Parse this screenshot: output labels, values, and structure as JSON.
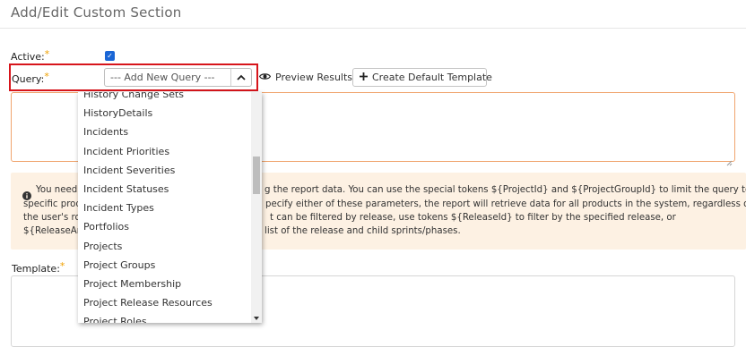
{
  "page": {
    "title": "Add/Edit Custom Section"
  },
  "form": {
    "active_label": "Active:",
    "required_mark": "*",
    "query_label": "Query:",
    "query_select_value": "--- Add New Query ---",
    "preview_button": "Preview Results",
    "create_template_button": "Create Default Template",
    "template_label": "Template:"
  },
  "alert": {
    "lines": [
      "You need",
      "specific prod",
      "the user's ro",
      "${ReleaseAnd"
    ],
    "tails": [
      "g the report data. You can use the special tokens ${ProjectId} and ${ProjectGroupId} to limit the query to a",
      "pecify either of these parameters, the report will retrieve data for all products in the system, regardless of",
      "t can be filtered by release, use tokens ${ReleaseId} to filter by the specified release, or",
      "list of the release and child sprints/phases."
    ]
  },
  "dropdown": {
    "items": [
      "History Change Sets",
      "HistoryDetails",
      "Incidents",
      "Incident Priorities",
      "Incident Severities",
      "Incident Statuses",
      "Incident Types",
      "Portfolios",
      "Projects",
      "Project Groups",
      "Project Membership",
      "Project Release Resources",
      "Project Roles"
    ]
  },
  "colors": {
    "required": "#f0a000",
    "highlight_border": "#d7151b",
    "checkbox": "#1a66d6",
    "alert_bg": "#fdf1e3",
    "query_border": "#f0a56e"
  },
  "icons": {
    "preview": "eye-icon",
    "create": "plus-icon",
    "select": "chevron-up-icon",
    "alert": "info-circle-icon"
  }
}
